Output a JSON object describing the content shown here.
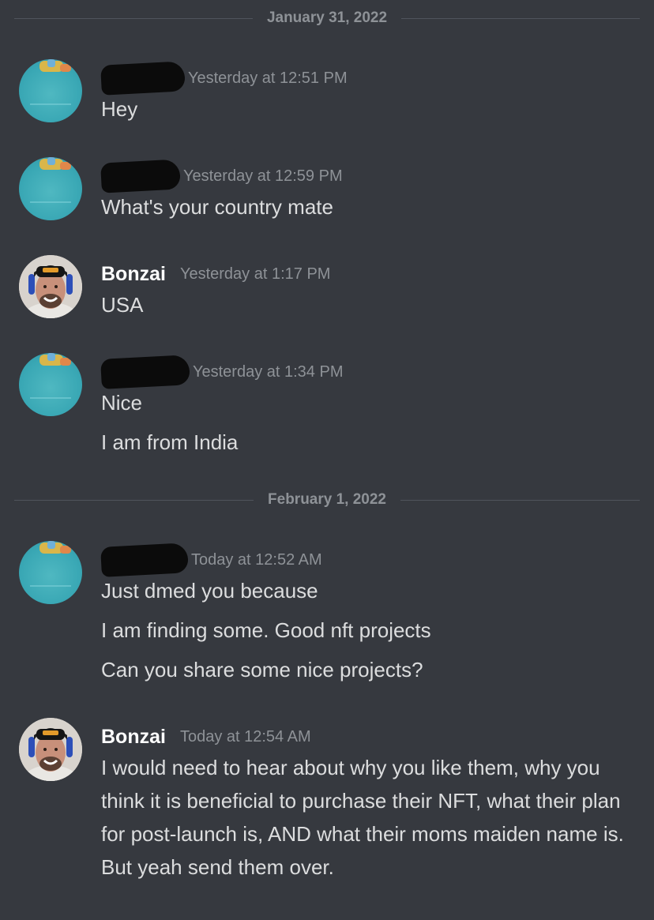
{
  "dividers": [
    "January 31, 2022",
    "February 1, 2022"
  ],
  "bonzai_name": "Bonzai",
  "messages": [
    {
      "time": "Yesterday at 12:51 PM",
      "lines": [
        "Hey"
      ]
    },
    {
      "time": "Yesterday at 12:59 PM",
      "lines": [
        "What's your country mate"
      ]
    },
    {
      "time": "Yesterday at 1:17 PM",
      "lines": [
        "USA"
      ]
    },
    {
      "time": "Yesterday at 1:34 PM",
      "lines": [
        "Nice",
        "I am from India"
      ]
    },
    {
      "time": "Today at 12:52 AM",
      "lines": [
        "Just dmed you because",
        "I am finding some. Good nft projects",
        "Can you share some nice projects?"
      ]
    },
    {
      "time": "Today at 12:54 AM",
      "lines": [
        "I would need to hear about why you like them, why you think it is beneficial to purchase their NFT, what their plan for post-launch is, AND what their moms maiden name is. But yeah send them over."
      ]
    }
  ],
  "colors": {
    "background": "#36393f",
    "text": "#dcddde",
    "muted": "#8e9297",
    "divider": "#4f545c"
  }
}
